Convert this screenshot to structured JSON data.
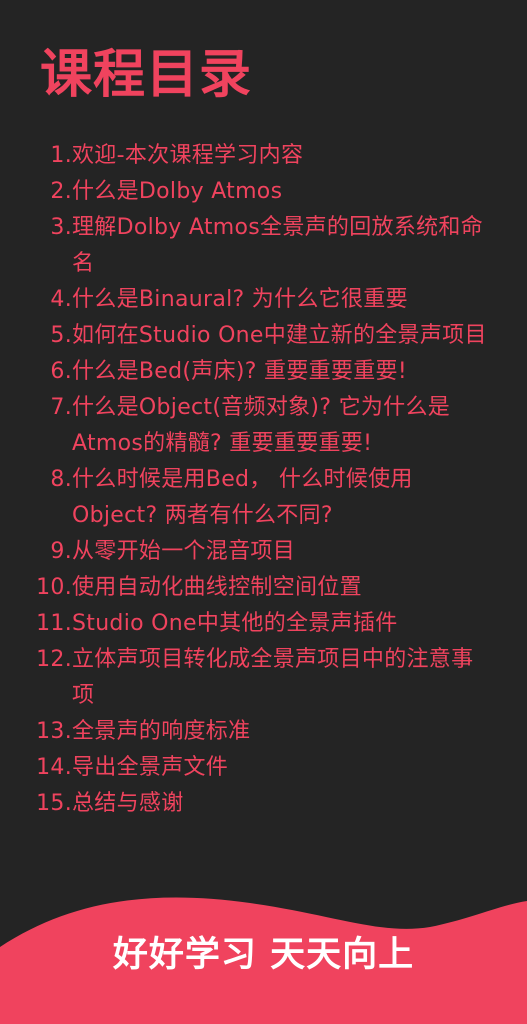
{
  "title": "课程目录",
  "items": [
    {
      "num": "1.",
      "text": "欢迎-本次课程学习内容"
    },
    {
      "num": "2.",
      "text": "什么是Dolby Atmos"
    },
    {
      "num": "3.",
      "text": "理解Dolby Atmos全景声的回放系统和命名"
    },
    {
      "num": "4.",
      "text": "什么是Binaural? 为什么它很重要"
    },
    {
      "num": "5.",
      "text": "如何在Studio One中建立新的全景声项目"
    },
    {
      "num": "6.",
      "text": "什么是Bed(声床)? 重要重要重要!"
    },
    {
      "num": "7.",
      "text": "什么是Object(音频对象)? 它为什么是Atmos的精髓? 重要重要重要!"
    },
    {
      "num": "8.",
      "text": "什么时候是用Bed， 什么时候使用Object? 两者有什么不同?"
    },
    {
      "num": "9.",
      "text": "从零开始一个混音项目"
    },
    {
      "num": "10.",
      "text": "使用自动化曲线控制空间位置"
    },
    {
      "num": "11.",
      "text": "Studio One中其他的全景声插件"
    },
    {
      "num": "12.",
      "text": "立体声项目转化成全景声项目中的注意事项"
    },
    {
      "num": "13.",
      "text": "全景声的响度标准"
    },
    {
      "num": "14.",
      "text": "导出全景声文件"
    },
    {
      "num": "15.",
      "text": "总结与感谢"
    }
  ],
  "footer": {
    "slogan": "好好学习 天天向上"
  },
  "colors": {
    "background": "#242424",
    "accent": "#f0435e",
    "footer_text": "#ffffff"
  }
}
